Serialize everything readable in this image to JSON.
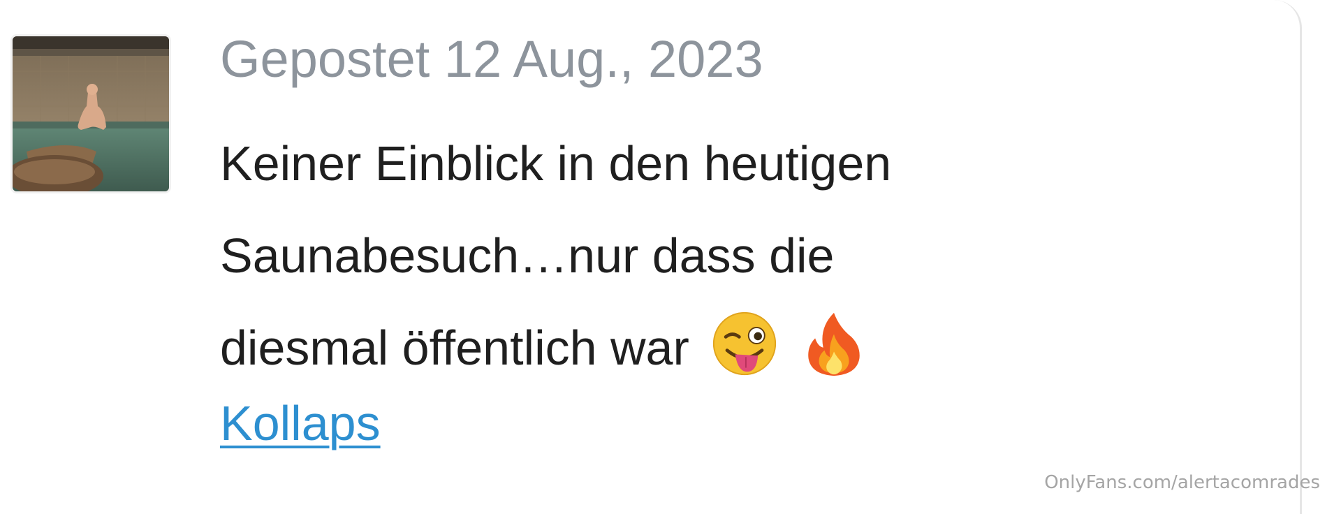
{
  "post": {
    "date_label": "Gepostet 12 Aug., 2023",
    "text_lines": [
      "Keiner Einblick in den heutigen",
      "Saunabesuch…nur dass die",
      "diesmal öffentlich war"
    ],
    "emojis": [
      "winking-tongue-emoji",
      "fire-emoji"
    ],
    "collapse_label": "Kollaps",
    "thumbnail": "sauna-photo"
  },
  "watermark": "OnlyFans.com/alertacomrades",
  "colors": {
    "date": "#8d949c",
    "text": "#1f1f1f",
    "link": "#2d8fd0",
    "watermark": "#a5a5a5"
  }
}
